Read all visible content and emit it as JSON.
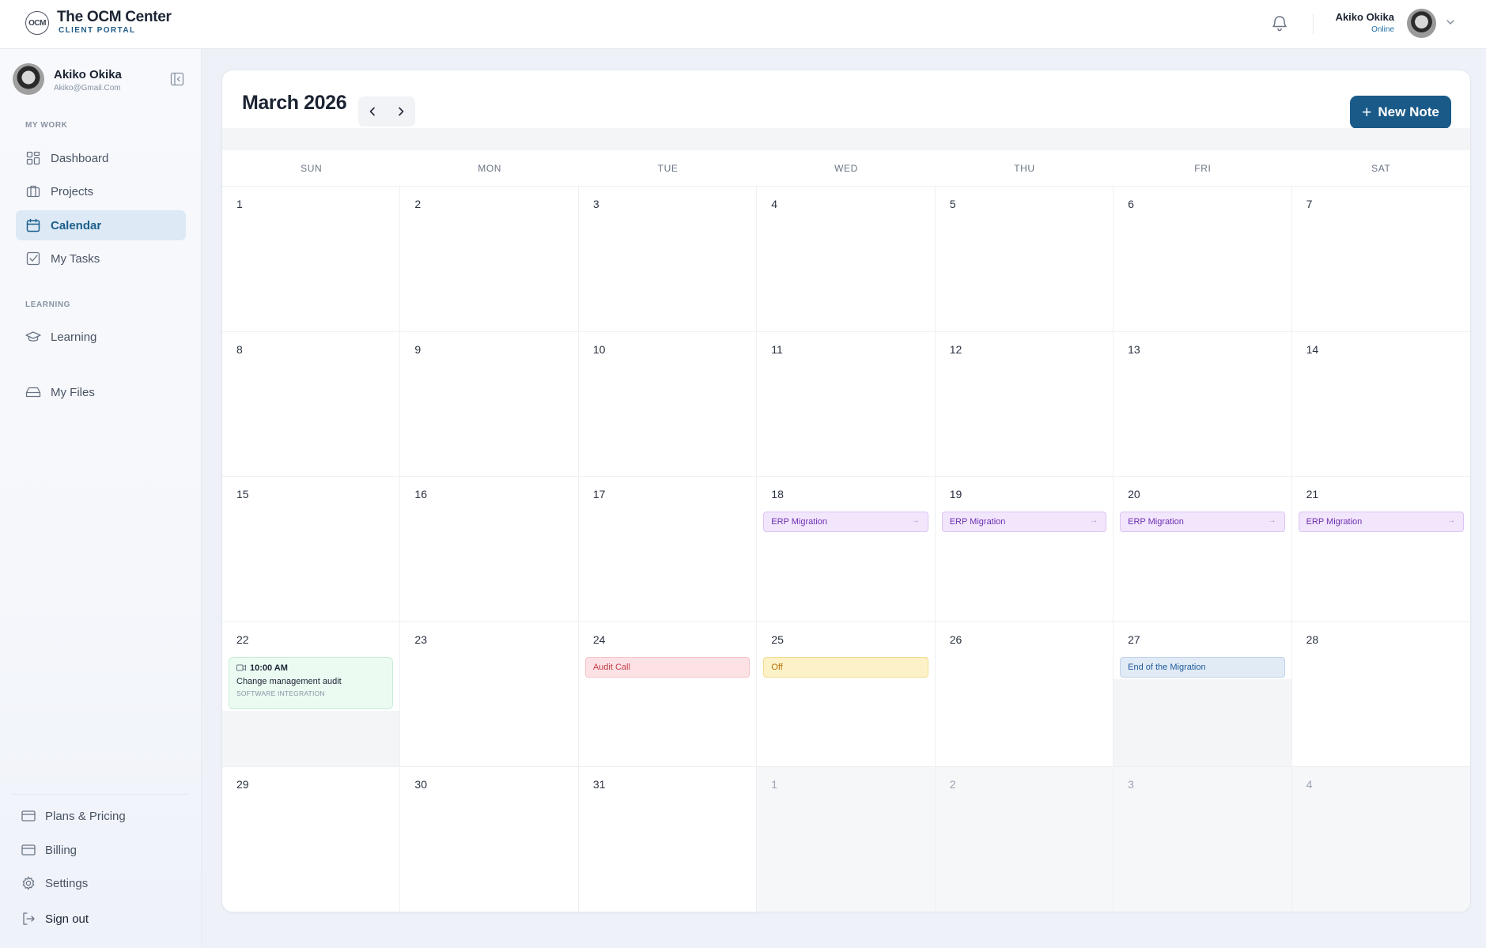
{
  "brand": {
    "mark": "OCM",
    "title": "The OCM Center",
    "subtitle": "CLIENT PORTAL"
  },
  "header": {
    "user_name": "Akiko Okika",
    "user_status": "Online"
  },
  "sidebar": {
    "user_name": "Akiko Okika",
    "user_email": "Akiko@Gmail.Com",
    "sections": {
      "my_work": "MY WORK",
      "learning": "LEARNING"
    },
    "items": [
      {
        "label": "Dashboard",
        "icon": "grid-icon"
      },
      {
        "label": "Projects",
        "icon": "briefcase-icon"
      },
      {
        "label": "Calendar",
        "icon": "calendar-icon",
        "active": true
      },
      {
        "label": "My Tasks",
        "icon": "checkbox-icon"
      },
      {
        "label": "Learning",
        "icon": "graduation-cap-icon"
      },
      {
        "label": "My Files",
        "icon": "drive-icon"
      }
    ],
    "bottom": [
      {
        "label": "Plans & Pricing",
        "icon": "card-icon"
      },
      {
        "label": "Billing",
        "icon": "card-icon"
      },
      {
        "label": "Settings",
        "icon": "gear-icon"
      },
      {
        "label": "Sign out",
        "icon": "sign-out-icon"
      }
    ]
  },
  "calendar": {
    "month_title": "March 2026",
    "new_note_label": "New Note",
    "weekdays": [
      "SUN",
      "MON",
      "TUE",
      "WED",
      "THU",
      "FRI",
      "SAT"
    ],
    "days": [
      {
        "d": "1"
      },
      {
        "d": "2"
      },
      {
        "d": "3"
      },
      {
        "d": "4"
      },
      {
        "d": "5"
      },
      {
        "d": "6"
      },
      {
        "d": "7"
      },
      {
        "d": "8"
      },
      {
        "d": "9"
      },
      {
        "d": "10"
      },
      {
        "d": "11"
      },
      {
        "d": "12"
      },
      {
        "d": "13"
      },
      {
        "d": "14"
      },
      {
        "d": "15"
      },
      {
        "d": "16"
      },
      {
        "d": "17"
      },
      {
        "d": "18",
        "event": {
          "label": "ERP Migration",
          "kind": "erp",
          "arrow": "→"
        }
      },
      {
        "d": "19",
        "event": {
          "label": "ERP Migration",
          "kind": "erp",
          "arrow": "→"
        }
      },
      {
        "d": "20",
        "event": {
          "label": "ERP Migration",
          "kind": "erp",
          "arrow": "→"
        }
      },
      {
        "d": "21",
        "event": {
          "label": "ERP Migration",
          "kind": "erp",
          "arrow": "→"
        }
      },
      {
        "d": "22",
        "meeting": {
          "time": "10:00 AM",
          "title": "Change management audit",
          "tag": "SOFTWARE INTEGRATION"
        }
      },
      {
        "d": "23"
      },
      {
        "d": "24",
        "event": {
          "label": "Audit Call",
          "kind": "audit"
        }
      },
      {
        "d": "25",
        "event": {
          "label": "Off",
          "kind": "off"
        }
      },
      {
        "d": "26"
      },
      {
        "d": "27",
        "event": {
          "label": "End of the Migration",
          "kind": "end"
        },
        "shade": true
      },
      {
        "d": "28"
      },
      {
        "d": "29"
      },
      {
        "d": "30"
      },
      {
        "d": "31"
      },
      {
        "d": "1",
        "muted": true,
        "shade": true
      },
      {
        "d": "2",
        "muted": true,
        "shade": true
      },
      {
        "d": "3",
        "muted": true,
        "shade": true
      },
      {
        "d": "4",
        "muted": true,
        "shade": true
      }
    ]
  },
  "colors": {
    "accent": "#1a5a89",
    "active_nav_bg": "#dde9f4",
    "erp_event": "#f2e6fc",
    "audit_event": "#fde2e5",
    "off_event": "#fdf1c8",
    "end_event": "#e1ebf6",
    "meeting_event": "#ecfbf2"
  }
}
